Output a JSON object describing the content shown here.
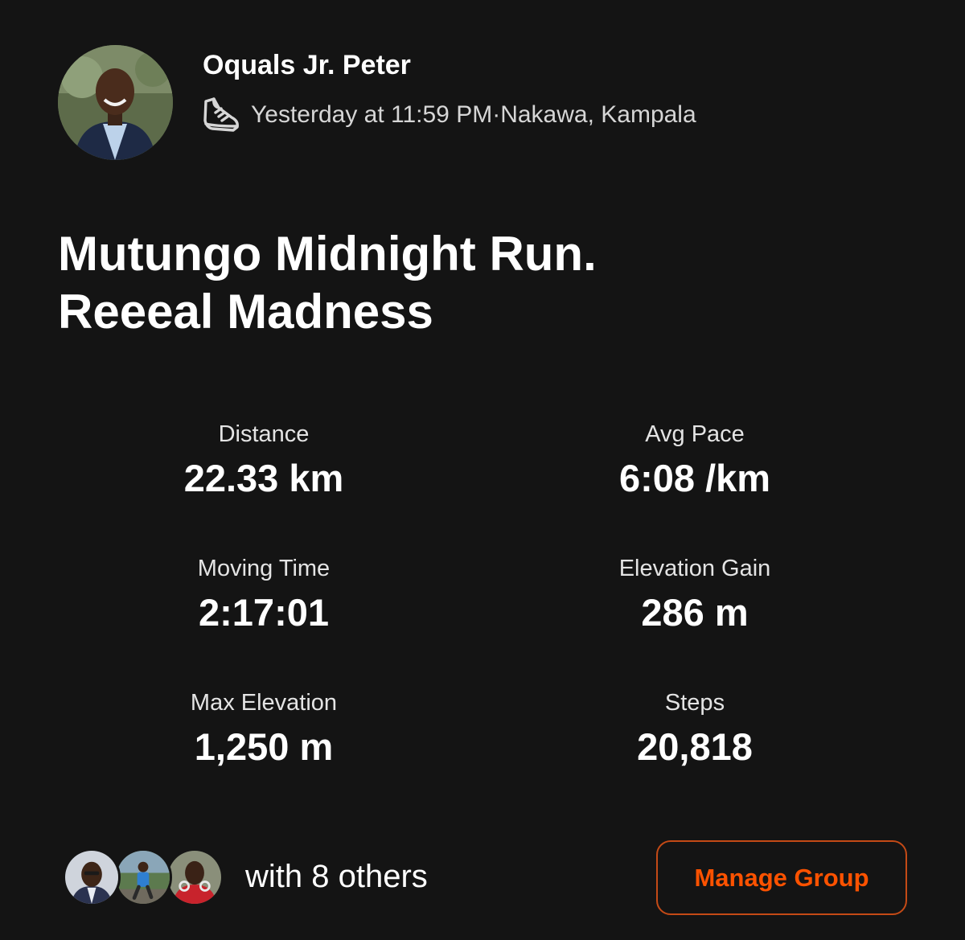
{
  "header": {
    "athlete_name": "Oquals Jr. Peter",
    "activity_icon": "running-shoe-icon",
    "timestamp": "Yesterday at 11:59 PM",
    "separator": " · ",
    "location": "Nakawa, Kampala"
  },
  "activity": {
    "title": "Mutungo Midnight Run.\nReeeal Madness"
  },
  "stats": [
    {
      "label": "Distance",
      "value": "22.33 km"
    },
    {
      "label": "Avg Pace",
      "value": "6:08 /km"
    },
    {
      "label": "Moving Time",
      "value": "2:17:01"
    },
    {
      "label": "Elevation Gain",
      "value": "286 m"
    },
    {
      "label": "Max Elevation",
      "value": "1,250 m"
    },
    {
      "label": "Steps",
      "value": "20,818"
    }
  ],
  "footer": {
    "with_others": "with 8 others",
    "manage_group_label": "Manage Group"
  },
  "colors": {
    "background": "#141414",
    "accent": "#fc5200",
    "button_border": "#c44a16"
  }
}
